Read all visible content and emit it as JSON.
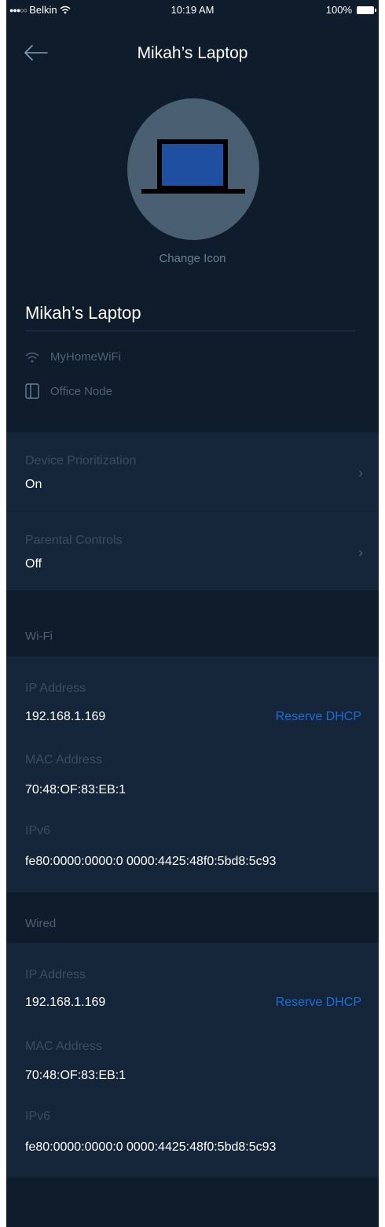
{
  "status_bar": {
    "carrier": "Belkin",
    "time": "10:19 AM",
    "battery": "100%"
  },
  "nav": {
    "title": "Mikah’s Laptop"
  },
  "device": {
    "change_icon_label": "Change Icon",
    "name": "Mikah’s Laptop",
    "network": "MyHomeWiFi",
    "node": "Office Node"
  },
  "settings": [
    {
      "label": "Device Prioritization",
      "value": "On"
    },
    {
      "label": "Parental Controls",
      "value": "Off"
    }
  ],
  "wifi": {
    "header": "Wi-Fi",
    "ip_label": "IP Address",
    "ip_value": "192.168.1.169",
    "reserve_label": "Reserve DHCP",
    "mac_label": "MAC Address",
    "mac_value": "70:48:OF:83:EB:1",
    "ipv6_label": "IPv6",
    "ipv6_value": "fe80:0000:0000:0 0000:4425:48f0:5bd8:5c93"
  },
  "wired": {
    "header": "Wired",
    "ip_label": "IP Address",
    "ip_value": "192.168.1.169",
    "reserve_label": "Reserve DHCP",
    "mac_label": "MAC Address",
    "mac_value": "70:48:OF:83:EB:1",
    "ipv6_label": "IPv6",
    "ipv6_value": "fe80:0000:0000:0 0000:4425:48f0:5bd8:5c93"
  },
  "colors": {
    "background": "#0f1c2c",
    "section": "#15253a",
    "link": "#1d6fd6",
    "avatar": "#4a6072"
  },
  "icons": {
    "back": "arrow-left-icon",
    "wifi": "wifi-icon",
    "node": "node-icon",
    "chevron": "chevron-right-icon"
  }
}
